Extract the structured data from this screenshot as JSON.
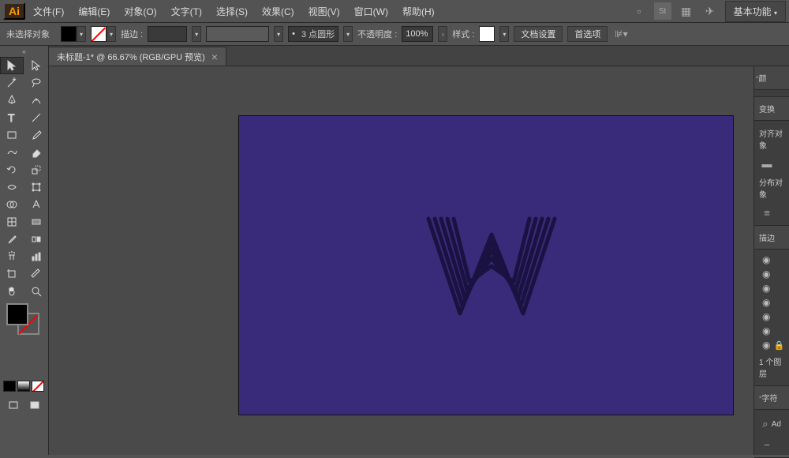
{
  "app_logo": "Ai",
  "menu": {
    "file": "文件(F)",
    "edit": "编辑(E)",
    "object": "对象(O)",
    "type": "文字(T)",
    "select": "选择(S)",
    "effect": "效果(C)",
    "view": "视图(V)",
    "window": "窗口(W)",
    "help": "帮助(H)"
  },
  "workspace_label": "基本功能",
  "controlbar": {
    "no_selection": "未选择对象",
    "stroke_label": "描边 :",
    "brush_value": "3 点圆形",
    "opacity_label": "不透明度 :",
    "opacity_value": "100%",
    "style_label": "样式 :",
    "doc_setup": "文档设置",
    "preferences": "首选项"
  },
  "doctab": {
    "title": "未标题-1* @ 66.67% (RGB/GPU 预览)",
    "close": "×"
  },
  "right": {
    "color_label": "颜",
    "transform_label": "变换",
    "align_label": "对齐对象",
    "distribute_label": "分布对象",
    "stroke_label": "描边",
    "layers_count": "1 个图层",
    "char_label": "字符",
    "ad_prefix": "Ad"
  },
  "colors": {
    "artboard": "#3a2a7a"
  }
}
